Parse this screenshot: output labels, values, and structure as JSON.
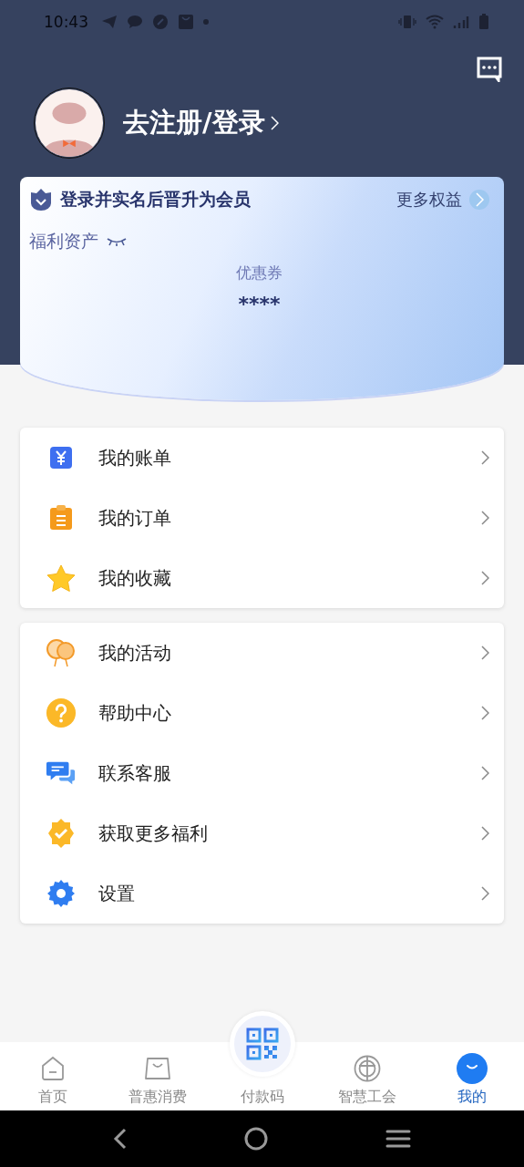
{
  "status_bar": {
    "time": "10:43"
  },
  "profile": {
    "login_link": "去注册/登录"
  },
  "member_card": {
    "title": "登录并实名后晋升为会员",
    "more_link": "更多权益",
    "assets_label": "福利资产",
    "assets_hidden": true,
    "coupon_label": "优惠券",
    "coupon_value": "****"
  },
  "menu_groups": [
    {
      "items": [
        {
          "label": "我的账单",
          "kind": "bill"
        },
        {
          "label": "我的订单",
          "kind": "order"
        },
        {
          "label": "我的收藏",
          "kind": "favorite"
        }
      ]
    },
    {
      "items": [
        {
          "label": "我的活动",
          "kind": "activity"
        },
        {
          "label": "帮助中心",
          "kind": "help"
        },
        {
          "label": "联系客服",
          "kind": "service"
        },
        {
          "label": "获取更多福利",
          "kind": "benefit"
        },
        {
          "label": "设置",
          "kind": "settings"
        }
      ]
    }
  ],
  "bottom_nav": [
    {
      "label": "首页",
      "kind": "home",
      "selected": false
    },
    {
      "label": "普惠消费",
      "kind": "shop",
      "selected": false
    },
    {
      "label": "付款码",
      "kind": "pay",
      "selected": false
    },
    {
      "label": "智慧工会",
      "kind": "union",
      "selected": false
    },
    {
      "label": "我的",
      "kind": "me",
      "selected": true
    }
  ]
}
